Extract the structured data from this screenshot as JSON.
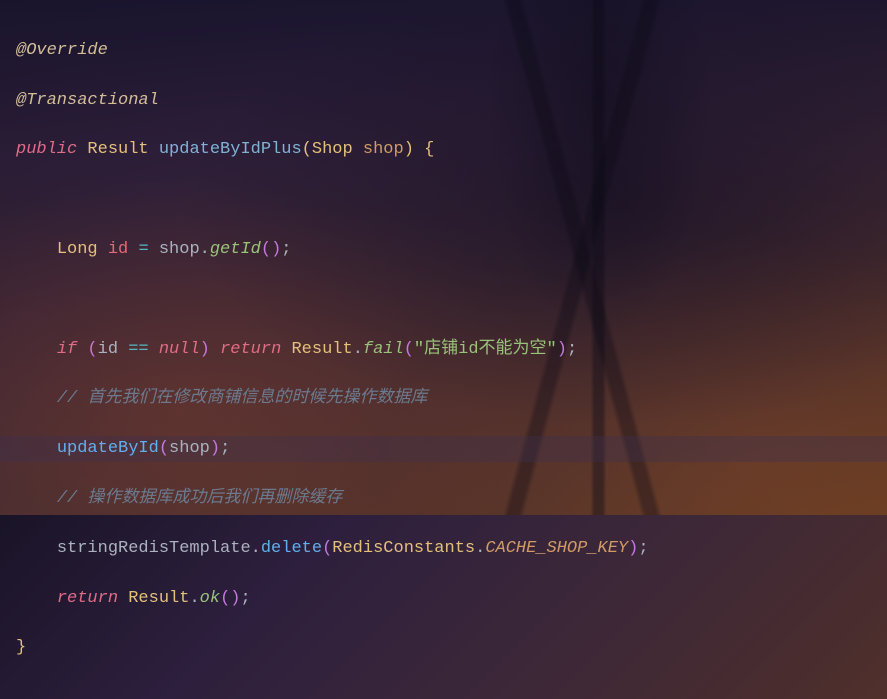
{
  "code": {
    "annotation_override": "@Override",
    "annotation_transactional": "@Transactional",
    "kw_public": "public",
    "type_result": "Result",
    "method_name": "updateByIdPlus",
    "type_shop": "Shop",
    "param_shop": "shop",
    "type_long": "Long",
    "var_id": "id",
    "method_getid": "getId",
    "kw_if": "if",
    "kw_null": "null",
    "kw_return": "return",
    "method_fail": "fail",
    "string_fail": "\"店铺id不能为空\"",
    "comment1": "// 首先我们在修改商铺信息的时候先操作数据库",
    "method_updatebyid": "updateById",
    "comment2": "// 操作数据库成功后我们再删除缓存",
    "var_template": "stringRedisTemplate",
    "method_delete": "delete",
    "type_redisconstants": "RedisConstants",
    "const_cache_key": "CACHE_SHOP_KEY",
    "method_ok": "ok",
    "op_eq": "=",
    "op_deq": "==",
    "open_brace": "{",
    "close_brace": "}",
    "semi": ";",
    "dot": "."
  }
}
